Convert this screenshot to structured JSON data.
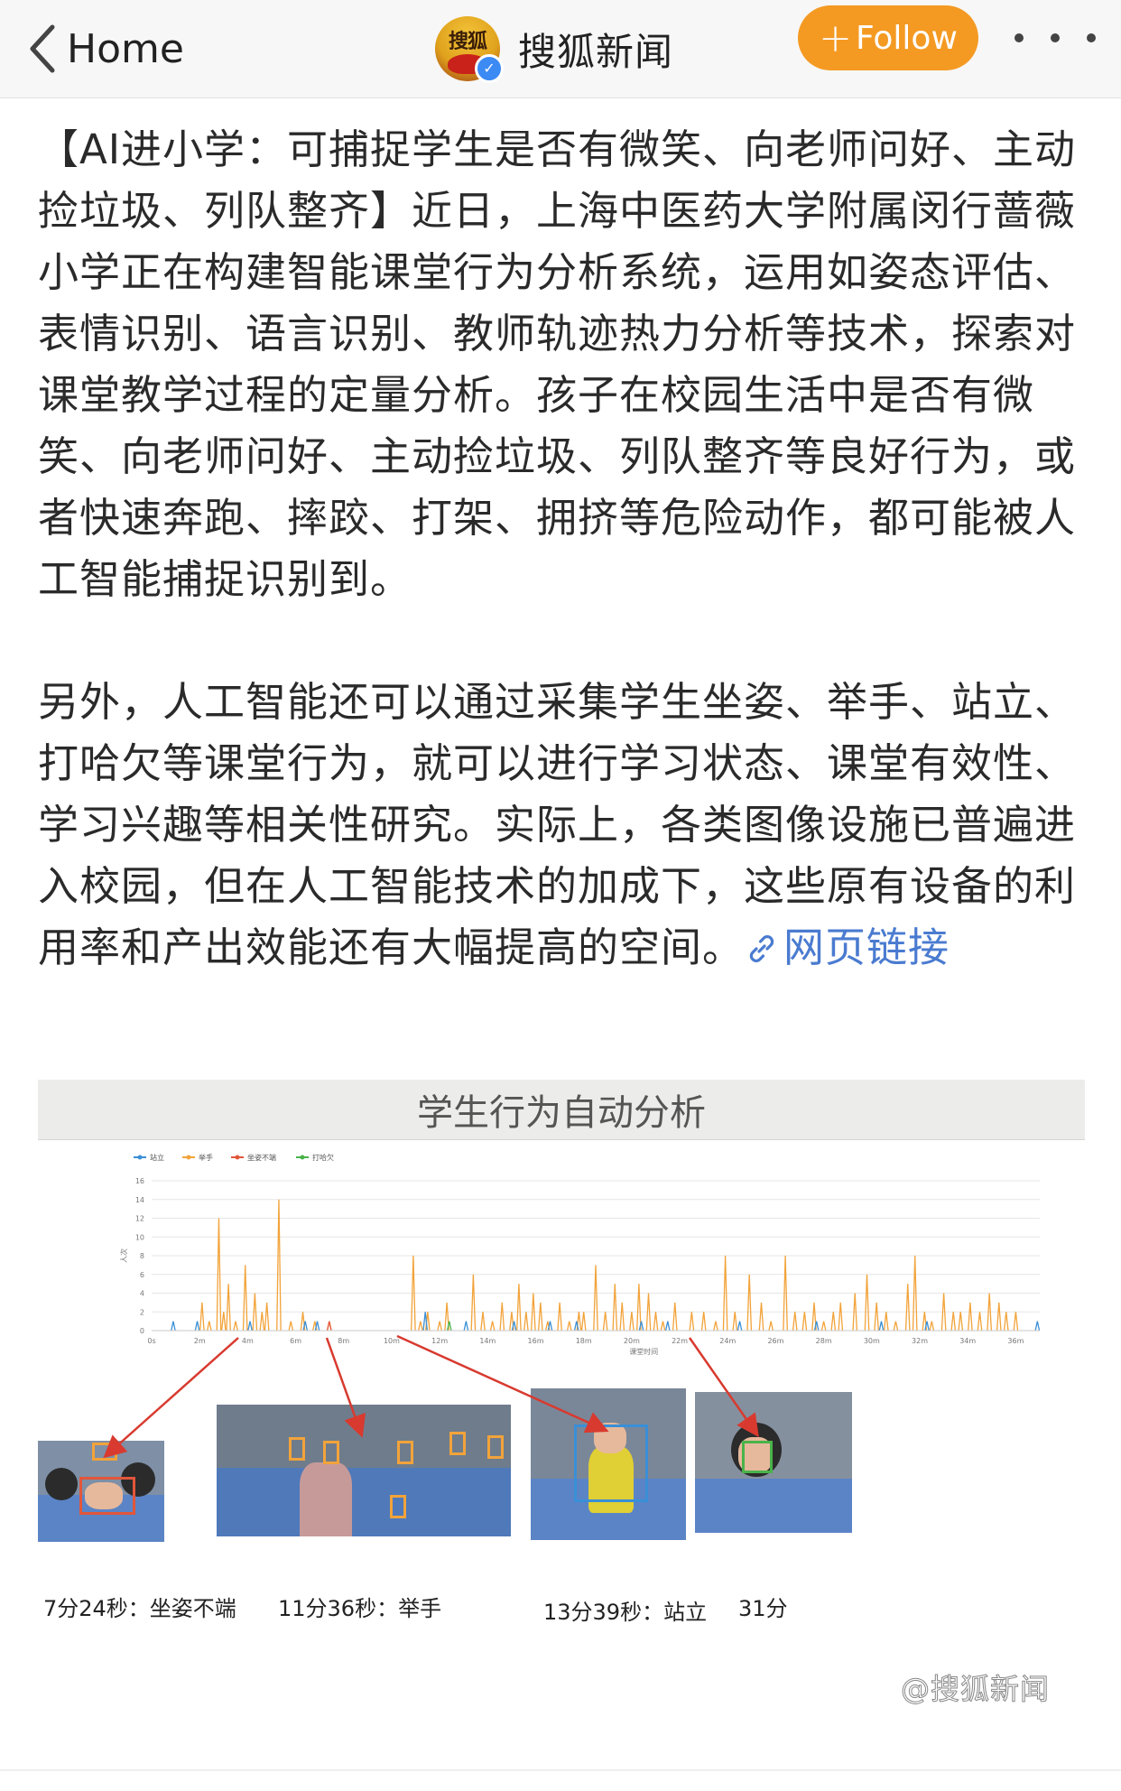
{
  "nav": {
    "back_label": "Home",
    "account_name": "搜狐新闻",
    "avatar_text": "搜狐",
    "follow_label": "Follow"
  },
  "post": {
    "paragraph1": "【AI进小学：可捕捉学生是否有微笑、向老师问好、主动捡垃圾、列队整齐】近日，上海中医药大学附属闵行蔷薇小学正在构建智能课堂行为分析系统，运用如姿态评估、表情识别、语言识别、教师轨迹热力分析等技术，探索对课堂教学过程的定量分析。孩子在校园生活中是否有微笑、向老师问好、主动捡垃圾、列队整齐等良好行为，或者快速奔跑、摔跤、打架、拥挤等危险动作，都可能被人工智能捕捉识别到。",
    "paragraph2": "另外，人工智能还可以通过采集学生坐姿、举手、站立、打哈欠等课堂行为，就可以进行学习状态、课堂有效性、学习兴趣等相关性研究。实际上，各类图像设施已普遍进入校园，但在人工智能技术的加成下，这些原有设备的利用率和产出效能还有大幅提高的空间。",
    "link_label": "网页链接"
  },
  "figure": {
    "title": "学生行为自动分析",
    "captions": [
      "7分24秒：坐姿不端",
      "11分36秒：举手",
      "13分39秒：站立",
      "31分"
    ],
    "watermark": "@搜狐新闻"
  },
  "chart_data": {
    "type": "bar",
    "legend": [
      "站立",
      "举手",
      "坐姿不端",
      "打哈欠"
    ],
    "series_colors": [
      "#3a8fd6",
      "#f2a33a",
      "#e2563a",
      "#49b34a"
    ],
    "ylabel": "人次",
    "xlabel": "课堂时间",
    "ylim": [
      0,
      16
    ],
    "yticks": [
      0,
      2,
      4,
      6,
      8,
      10,
      12,
      14,
      16
    ],
    "xticks": [
      "0s",
      "2m",
      "4m",
      "6m",
      "8m",
      "10m",
      "12m",
      "14m",
      "16m",
      "18m",
      "20m",
      "22m",
      "24m",
      "26m",
      "28m",
      "30m",
      "32m",
      "34m",
      "36m"
    ],
    "xmax_minutes": 37,
    "series": [
      {
        "name": "举手",
        "points": [
          [
            2.1,
            3
          ],
          [
            2.4,
            1
          ],
          [
            2.8,
            12
          ],
          [
            3.0,
            2
          ],
          [
            3.2,
            5
          ],
          [
            3.5,
            1
          ],
          [
            3.9,
            7
          ],
          [
            4.3,
            4
          ],
          [
            4.6,
            2
          ],
          [
            4.8,
            3
          ],
          [
            5.3,
            14
          ],
          [
            5.8,
            1
          ],
          [
            6.3,
            2
          ],
          [
            6.8,
            1
          ],
          [
            7.4,
            1
          ],
          [
            10.9,
            8
          ],
          [
            11.2,
            1
          ],
          [
            11.5,
            2
          ],
          [
            12.0,
            1
          ],
          [
            12.3,
            3
          ],
          [
            13.4,
            6
          ],
          [
            13.8,
            2
          ],
          [
            14.2,
            1
          ],
          [
            14.6,
            3
          ],
          [
            15.0,
            2
          ],
          [
            15.3,
            5
          ],
          [
            15.6,
            2
          ],
          [
            15.9,
            4
          ],
          [
            16.2,
            3
          ],
          [
            16.5,
            1
          ],
          [
            17.0,
            3
          ],
          [
            17.4,
            1
          ],
          [
            17.8,
            2
          ],
          [
            18.0,
            2
          ],
          [
            18.5,
            7
          ],
          [
            18.9,
            2
          ],
          [
            19.3,
            5
          ],
          [
            19.6,
            3
          ],
          [
            20.0,
            2
          ],
          [
            20.3,
            5
          ],
          [
            20.7,
            4
          ],
          [
            21.0,
            2
          ],
          [
            21.3,
            1
          ],
          [
            21.8,
            3
          ],
          [
            22.5,
            2
          ],
          [
            23.0,
            2
          ],
          [
            23.5,
            1
          ],
          [
            23.9,
            8
          ],
          [
            24.3,
            2
          ],
          [
            24.9,
            6
          ],
          [
            25.4,
            3
          ],
          [
            25.8,
            1
          ],
          [
            26.4,
            8
          ],
          [
            26.8,
            2
          ],
          [
            27.2,
            2
          ],
          [
            27.6,
            3
          ],
          [
            28.0,
            1
          ],
          [
            28.4,
            2
          ],
          [
            28.7,
            3
          ],
          [
            29.3,
            4
          ],
          [
            29.8,
            6
          ],
          [
            30.2,
            3
          ],
          [
            30.6,
            2
          ],
          [
            31.0,
            1
          ],
          [
            31.5,
            5
          ],
          [
            31.8,
            8
          ],
          [
            32.2,
            2
          ],
          [
            32.5,
            1
          ],
          [
            33.0,
            4
          ],
          [
            33.4,
            2
          ],
          [
            33.7,
            2
          ],
          [
            34.1,
            3
          ],
          [
            34.5,
            2
          ],
          [
            34.9,
            4
          ],
          [
            35.3,
            3
          ],
          [
            35.6,
            2
          ],
          [
            36.0,
            2
          ]
        ]
      },
      {
        "name": "站立",
        "points": [
          [
            0.9,
            1
          ],
          [
            1.9,
            1
          ],
          [
            4.1,
            1
          ],
          [
            6.4,
            1
          ],
          [
            6.9,
            1
          ],
          [
            11.4,
            2
          ],
          [
            13.1,
            1
          ],
          [
            15.1,
            1
          ],
          [
            16.6,
            1
          ],
          [
            17.7,
            1
          ],
          [
            20.4,
            1
          ],
          [
            21.5,
            1
          ],
          [
            24.5,
            1
          ],
          [
            27.7,
            1
          ],
          [
            30.4,
            1
          ],
          [
            32.3,
            1
          ],
          [
            36.9,
            1
          ]
        ]
      },
      {
        "name": "坐姿不端",
        "points": [
          [
            7.4,
            1
          ]
        ]
      },
      {
        "name": "打哈欠",
        "points": [
          [
            12.4,
            1
          ]
        ]
      }
    ]
  }
}
